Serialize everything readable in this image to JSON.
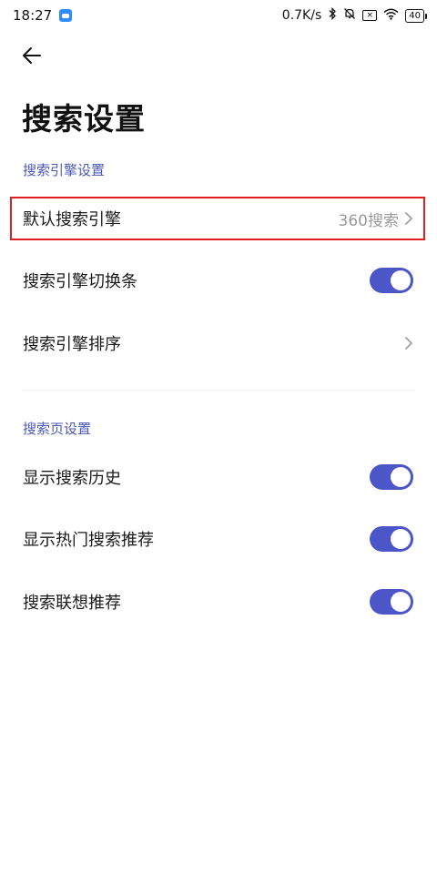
{
  "status_bar": {
    "time": "18:27",
    "net_speed": "0.7K/s",
    "battery": "40"
  },
  "page": {
    "title": "搜索设置"
  },
  "sections": {
    "engine": {
      "label": "搜索引擎设置",
      "default_engine": {
        "label": "默认搜索引擎",
        "value": "360搜索"
      },
      "switch_bar": {
        "label": "搜索引擎切换条",
        "on": true
      },
      "order": {
        "label": "搜索引擎排序"
      }
    },
    "search_page": {
      "label": "搜索页设置",
      "history": {
        "label": "显示搜索历史",
        "on": true
      },
      "hot": {
        "label": "显示热门搜索推荐",
        "on": true
      },
      "suggest": {
        "label": "搜索联想推荐",
        "on": true
      }
    }
  },
  "colors": {
    "accent": "#4c56c8",
    "section_label": "#4b58b8",
    "highlight_border": "#e02020"
  },
  "icons": [
    "arrow-left-icon",
    "chevron-right-icon",
    "bluetooth-icon",
    "bell-off-icon",
    "wifi-icon",
    "battery-icon"
  ]
}
